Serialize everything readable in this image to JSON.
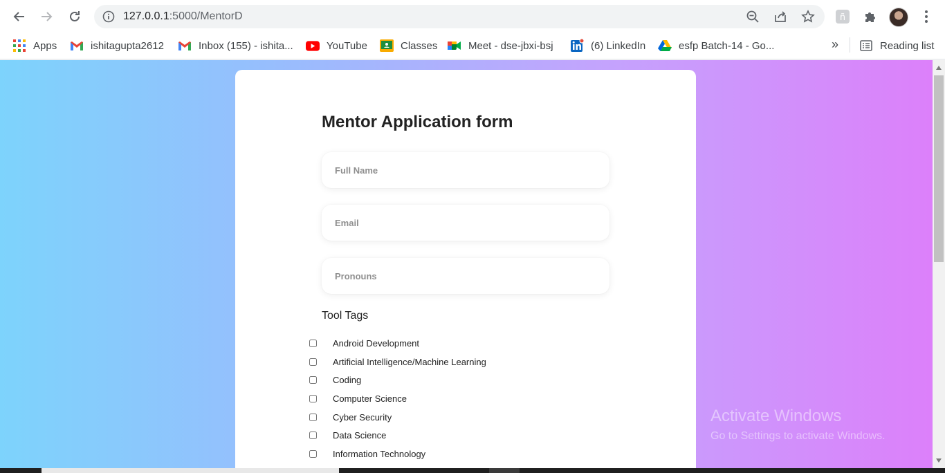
{
  "browser": {
    "url_host": "127.0.0.1",
    "url_path": ":5000/MentorD",
    "bookmarks": [
      {
        "label": "Apps",
        "icon": "apps-grid-icon"
      },
      {
        "label": "ishitagupta2612",
        "icon": "gmail-icon"
      },
      {
        "label": "Inbox (155) - ishita...",
        "icon": "gmail-icon"
      },
      {
        "label": "YouTube",
        "icon": "youtube-icon"
      },
      {
        "label": "Classes",
        "icon": "classroom-icon"
      },
      {
        "label": "Meet - dse-jbxi-bsj",
        "icon": "meet-icon"
      },
      {
        "label": "(6) LinkedIn",
        "icon": "linkedin-icon"
      },
      {
        "label": "esfp Batch-14 - Go...",
        "icon": "drive-icon"
      }
    ],
    "more_bookmarks": "»",
    "reading_list": "Reading list"
  },
  "form": {
    "title": "Mentor Application form",
    "full_name_placeholder": "Full Name",
    "email_placeholder": "Email",
    "pronouns_placeholder": "Pronouns",
    "tool_tags_label": "Tool Tags",
    "tags": [
      {
        "label": "Android Development",
        "checked": false
      },
      {
        "label": "Artificial Intelligence/Machine Learning",
        "checked": false
      },
      {
        "label": "Coding",
        "checked": false
      },
      {
        "label": "Computer Science",
        "checked": false
      },
      {
        "label": "Cyber Security",
        "checked": false
      },
      {
        "label": "Data Science",
        "checked": false
      },
      {
        "label": "Information Technology",
        "checked": false
      }
    ]
  },
  "watermark": {
    "line1": "Activate Windows",
    "line2": "Go to Settings to activate Windows."
  },
  "colors": {
    "gradient_start": "#7dd3fc",
    "gradient_end": "#dc80fa"
  }
}
